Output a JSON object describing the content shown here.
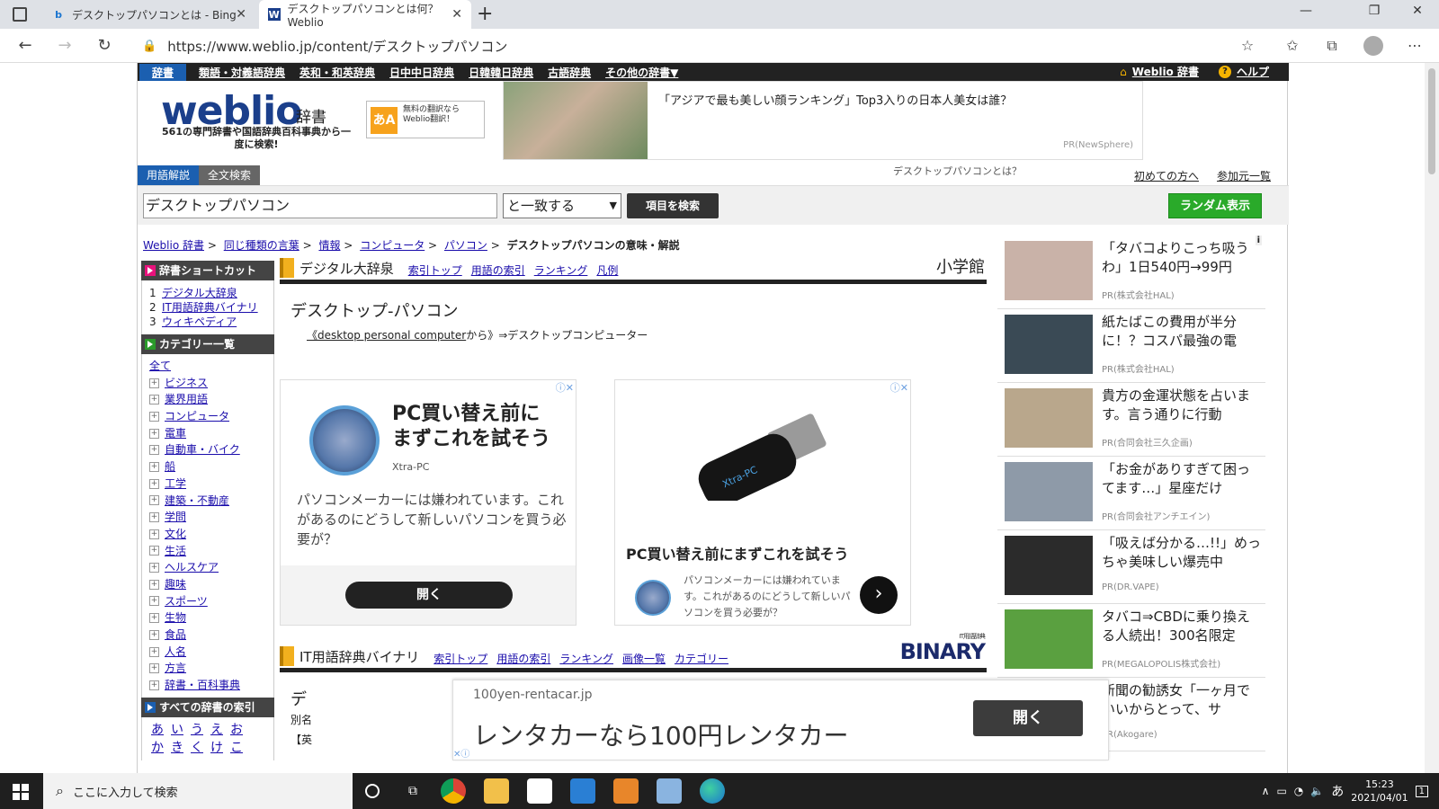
{
  "browser": {
    "tabs": [
      {
        "title": "デスクトップパソコンとは - Bing",
        "icon": "bing-icon"
      },
      {
        "title": "デスクトップパソコンとは何？ Weblio",
        "icon": "weblio-icon"
      }
    ],
    "new_tab": "+",
    "url": "https://www.weblio.jp/content/デスクトップパソコン"
  },
  "dictnav": {
    "items": [
      "辞書",
      "類語・対義語辞典",
      "英和・和英辞典",
      "日中中日辞典",
      "日韓韓日辞典",
      "古語辞典",
      "その他の辞書▼"
    ],
    "home": "Weblio 辞書",
    "help": "ヘルプ"
  },
  "logo": {
    "name": "weblio",
    "suffix": "辞書",
    "tagline": "561の専門辞書や国語辞典百科事典から一度に検索!"
  },
  "translate_ad": {
    "icon_text": "あA",
    "text": "無料の翻訳なら Weblio翻訳！"
  },
  "top_ad": {
    "title": "「アジアで最も美しい顔ランキング」Top3入りの日本人美女は誰？",
    "pr": "PR(NewSphere)"
  },
  "search": {
    "tabs": [
      "用語解説",
      "全文検索"
    ],
    "whatis": "デスクトップパソコンとは？",
    "links": [
      "初めての方へ",
      "参加元一覧"
    ],
    "query": "デスクトップパソコン",
    "match": "と一致する",
    "button": "項目を検索",
    "random": "ランダム表示"
  },
  "breadcrumb": {
    "items": [
      "Weblio 辞書",
      "同じ種類の言葉",
      "情報",
      "コンピュータ",
      "パソコン"
    ],
    "sep": ">",
    "current": "デスクトップパソコンの意味・解説"
  },
  "sidebar": {
    "shortcut_title": "辞書ショートカット",
    "shortcuts": [
      {
        "n": "1",
        "label": "デジタル大辞泉"
      },
      {
        "n": "2",
        "label": "IT用語辞典バイナリ"
      },
      {
        "n": "3",
        "label": "ウィキペディア"
      }
    ],
    "category_title": "カテゴリー一覧",
    "all": "全て",
    "categories": [
      "ビジネス",
      "業界用語",
      "コンピュータ",
      "電車",
      "自動車・バイク",
      "船",
      "工学",
      "建築・不動産",
      "学問",
      "文化",
      "生活",
      "ヘルスケア",
      "趣味",
      "スポーツ",
      "生物",
      "食品",
      "人名",
      "方言",
      "辞書・百科事典"
    ],
    "index_title": "すべての辞書の索引",
    "kana_row1": [
      "あ",
      "い",
      "う",
      "え",
      "お"
    ],
    "kana_row2": [
      "か",
      "き",
      "く",
      "け",
      "こ"
    ]
  },
  "dict1": {
    "name": "デジタル大辞泉",
    "links": [
      "索引トップ",
      "用語の索引",
      "ランキング",
      "凡例"
    ],
    "publisher": "小学館",
    "term": "デスクトップ‐パソコン",
    "definition_link": "《desktop personal computer",
    "definition_rest": "から》⇒デスクトップコンピューター"
  },
  "ad1": {
    "headline1": "PC買い替え前に",
    "headline2": "まずこれを試そう",
    "sponsor": "Xtra-PC",
    "desc": "パソコンメーカーには嫌われています。これがあるのにどうして新しいパソコンを買う必要が？",
    "button": "開く"
  },
  "ad2": {
    "headline": "PC買い替え前にまずこれを試そう",
    "desc": "パソコンメーカーには嫌われています。これがあるのにどうして新しいパソコンを買う必要が？",
    "usb_label": "Xtra-PC",
    "button": "›"
  },
  "dict2": {
    "name": "IT用語辞典バイナリ",
    "links": [
      "索引トップ",
      "用語の索引",
      "ランキング",
      "画像一覧",
      "カテゴリー"
    ],
    "logo": "BINARY",
    "logo_small": "IT用語辞典",
    "partial": [
      "デ",
      "別名",
      "【英"
    ]
  },
  "right_ads": [
    {
      "title": "「タバコよりこっち吸うわ」1日540円→99円",
      "pr": "PR(株式会社HAL)",
      "color": "#c9b2a8"
    },
    {
      "title": "紙たばこの費用が半分に！？コスパ最強の電",
      "pr": "PR(株式会社HAL)",
      "color": "#3a4a55"
    },
    {
      "title": "貴方の金運状態を占います。言う通りに行動",
      "pr": "PR(合同会社三久企画)",
      "color": "#b9a78c"
    },
    {
      "title": "「お金がありすぎて困ってます…」星座だけ",
      "pr": "PR(合同会社アンチエイン)",
      "color": "#8e9aa8"
    },
    {
      "title": "「吸えば分かる…!!」めっちゃ美味しい爆売中",
      "pr": "PR(DR.VAPE)",
      "color": "#2b2b2b"
    },
    {
      "title": "タバコ⇒CBDに乗り換える人続出！300名限定",
      "pr": "PR(MEGALOPOLIS株式会社)",
      "color": "#5aa040"
    },
    {
      "title": "新聞の勧誘女「一ヶ月でいいからとって、サ",
      "pr": "PR(Akogare)",
      "color": "#c89a80"
    }
  ],
  "bottom_ad": {
    "domain": "100yen-rentacar.jp",
    "headline": "レンタカーなら100円レンタカー",
    "button": "開く"
  },
  "taskbar": {
    "search_placeholder": "ここに入力して検索",
    "time": "15:23",
    "date": "2021/04/01",
    "ime": "あ",
    "notif": "1"
  }
}
